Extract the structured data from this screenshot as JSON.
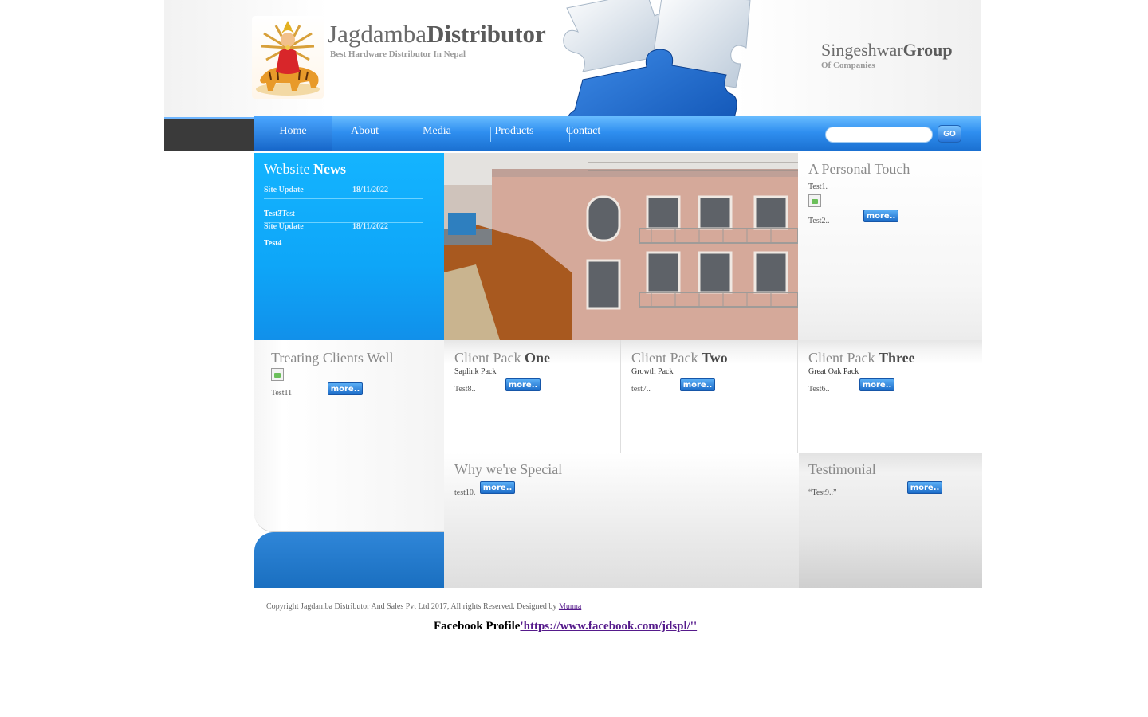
{
  "header": {
    "brand_light": "Jagdamba",
    "brand_bold": "Distributor",
    "tagline": "Best Hardware Distributor In Nepal",
    "group_light": "Singeshwar",
    "group_bold": "Group",
    "group_sub": "Of Companies"
  },
  "nav": {
    "items": [
      {
        "label": "Home"
      },
      {
        "label": "About"
      },
      {
        "label": "Media"
      },
      {
        "label": "Products"
      },
      {
        "label": "Contact"
      }
    ],
    "active": "Home",
    "search_placeholder": "",
    "go_label": "GO"
  },
  "news": {
    "title_light": "Website ",
    "title_bold": "News",
    "entries": [
      {
        "category": "Site Update",
        "date": "18/11/2022",
        "title": "Test3",
        "text": "Test"
      },
      {
        "category": "Site Update",
        "date": "18/11/2022",
        "title": "Test4",
        "text": ""
      }
    ]
  },
  "touch": {
    "title": "A Personal Touch",
    "line1": "Test1.",
    "line2": "Test2..",
    "more": "more.."
  },
  "treating": {
    "title": "Treating Clients Well",
    "text": "Test11",
    "more": "more.."
  },
  "packs": [
    {
      "title_light": "Client Pack ",
      "title_bold": "One",
      "sub": "Saplink Pack",
      "text": "Test8..",
      "more": "more.."
    },
    {
      "title_light": "Client Pack ",
      "title_bold": "Two",
      "sub": "Growth Pack",
      "text": "test7..",
      "more": "more.."
    },
    {
      "title_light": "Client Pack ",
      "title_bold": "Three",
      "sub": "Great Oak Pack",
      "text": "Test6..",
      "more": "more.."
    }
  ],
  "why": {
    "title": "Why we're Special",
    "text": "test10.",
    "more": "more.."
  },
  "testimonial": {
    "title": "Testimonial",
    "text": "“Test9..”",
    "more": "more.."
  },
  "footer": {
    "copyright": "Copyright Jagdamba Distributor And Sales Pvt Ltd 2017, All rights Reserved. Designed by ",
    "designer": "Munna",
    "fb_label": "Facebook Profile",
    "fb_link": "'https://www.facebook.com/jdspl/''"
  },
  "colors": {
    "nav_blue": "#2f8ff0",
    "news_blue": "#14b4ff",
    "dark_bar": "#3a3a3a",
    "link": "#551a8b"
  }
}
